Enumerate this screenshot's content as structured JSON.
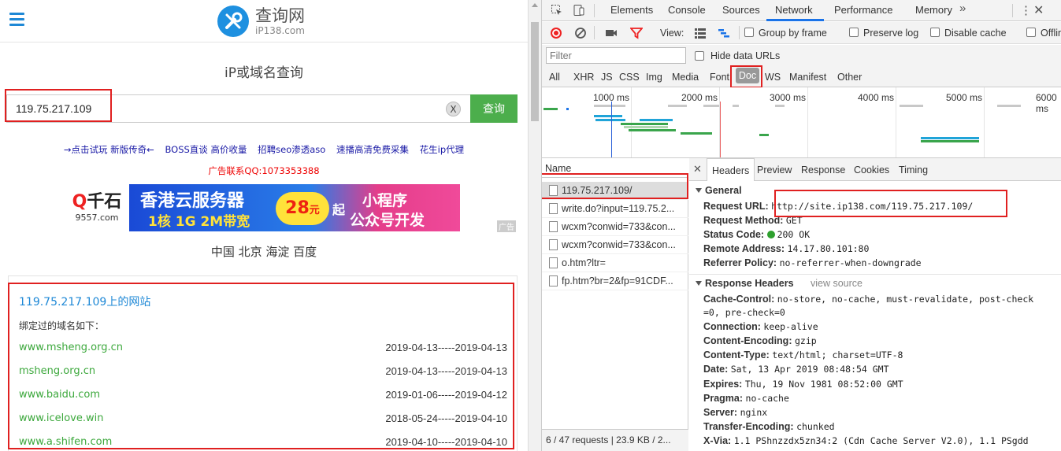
{
  "site": {
    "logo_cn": "查询网",
    "logo_en": "iP138.com",
    "title": "iP或域名查询",
    "search_value": "119.75.217.109",
    "clear_label": "X",
    "query_label": "查询",
    "ad_links": [
      "→点击试玩 新版传奇←",
      "BOSS直谈 高价收量",
      "招聘seo渗透aso",
      "速播高清免费采集",
      "花生ip代理"
    ],
    "ad_contact": "广告联系QQ:1073353388",
    "banner": {
      "logo_q": "千",
      "logo_prefix": "Q",
      "logo_suffix": "石",
      "logo_domain": "9557.com",
      "line1": "香港云服务器",
      "line2": "1核 1G 2M带宽",
      "price": "28",
      "price_unit": "元",
      "qi": "起",
      "right1": "小程序",
      "right2": "公众号开发"
    },
    "ad_tag": "广告",
    "location": "中国 北京 海淀 百度",
    "result_title": "119.75.217.109上的网站",
    "result_sub": "绑定过的域名如下：",
    "domains": [
      {
        "domain": "www.msheng.org.cn",
        "dates": "2019-04-13-----2019-04-13"
      },
      {
        "domain": "msheng.org.cn",
        "dates": "2019-04-13-----2019-04-13"
      },
      {
        "domain": "www.baidu.com",
        "dates": "2019-01-06-----2019-04-12"
      },
      {
        "domain": "www.icelove.win",
        "dates": "2018-05-24-----2019-04-10"
      },
      {
        "domain": "www.a.shifen.com",
        "dates": "2019-04-10-----2019-04-10"
      }
    ]
  },
  "devtools": {
    "tabs": [
      "Elements",
      "Console",
      "Sources",
      "Network",
      "Performance",
      "Memory"
    ],
    "active_tab": "Network",
    "more": "»",
    "toolbar": {
      "view_label": "View:",
      "group_by_frame": "Group by frame",
      "preserve_log": "Preserve log",
      "disable_cache": "Disable cache",
      "offline": "Offline"
    },
    "filter_placeholder": "Filter",
    "hide_data_urls": "Hide data URLs",
    "types": [
      "All",
      "XHR",
      "JS",
      "CSS",
      "Img",
      "Media",
      "Font",
      "Doc",
      "WS",
      "Manifest",
      "Other"
    ],
    "active_type": "Doc",
    "timeline_labels": [
      "1000 ms",
      "2000 ms",
      "3000 ms",
      "4000 ms",
      "5000 ms",
      "6000 ms"
    ],
    "name_header": "Name",
    "requests": [
      "119.75.217.109/",
      "write.do?input=119.75.2...",
      "wcxm?conwid=733&con...",
      "wcxm?conwid=733&con...",
      "o.htm?ltr=",
      "fp.htm?br=2&fp=91CDF..."
    ],
    "status_bar": "6 / 47 requests | 23.9 KB / 2...",
    "detail_tabs": [
      "Headers",
      "Preview",
      "Response",
      "Cookies",
      "Timing"
    ],
    "active_detail_tab": "Headers",
    "general": {
      "title": "General",
      "rows": [
        {
          "k": "Request URL:",
          "v": "http://site.ip138.com/119.75.217.109/"
        },
        {
          "k": "Request Method:",
          "v": "GET"
        },
        {
          "k": "Status Code:",
          "v": "200 OK"
        },
        {
          "k": "Remote Address:",
          "v": "14.17.80.101:80"
        },
        {
          "k": "Referrer Policy:",
          "v": "no-referrer-when-downgrade"
        }
      ]
    },
    "response_headers": {
      "title": "Response Headers",
      "view_source": "view source",
      "rows": [
        {
          "k": "Cache-Control:",
          "v": "no-store, no-cache, must-revalidate, post-check"
        },
        {
          "k": "",
          "v": "=0, pre-check=0"
        },
        {
          "k": "Connection:",
          "v": "keep-alive"
        },
        {
          "k": "Content-Encoding:",
          "v": "gzip"
        },
        {
          "k": "Content-Type:",
          "v": "text/html; charset=UTF-8"
        },
        {
          "k": "Date:",
          "v": "Sat, 13 Apr 2019 08:48:54 GMT"
        },
        {
          "k": "Expires:",
          "v": "Thu, 19 Nov 1981 08:52:00 GMT"
        },
        {
          "k": "Pragma:",
          "v": "no-cache"
        },
        {
          "k": "Server:",
          "v": "nginx"
        },
        {
          "k": "Transfer-Encoding:",
          "v": "chunked"
        },
        {
          "k": "X-Via:",
          "v": "1.1 PShnzzdx5zn34:2 (Cdn Cache Server V2.0), 1.1 PSgdd"
        }
      ]
    },
    "colors": {
      "accent": "#1a73e8",
      "green": "#4cae4c",
      "highlight": "#e02020"
    }
  }
}
